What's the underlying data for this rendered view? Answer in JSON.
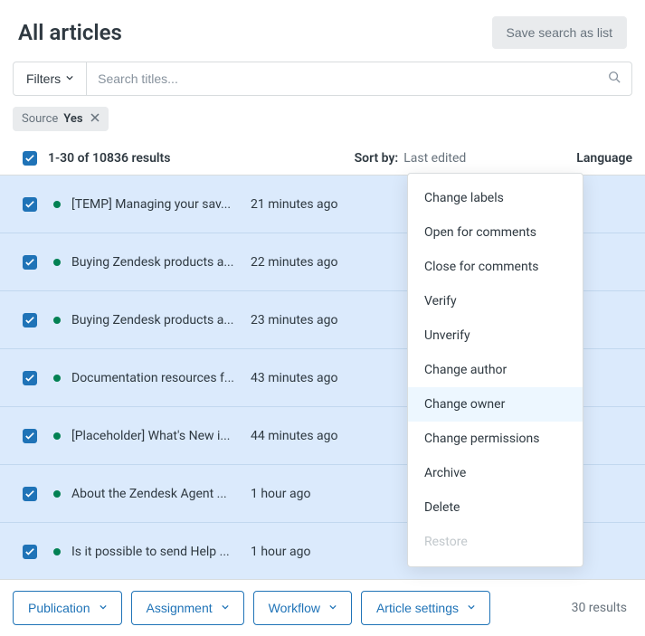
{
  "header": {
    "title": "All articles",
    "save_search": "Save search as list"
  },
  "filters": {
    "button": "Filters",
    "search_placeholder": "Search titles..."
  },
  "chip": {
    "label": "Source",
    "value": "Yes"
  },
  "list_header": {
    "count": "1-30 of 10836 results",
    "sort_label": "Sort by:",
    "sort_value": "Last edited",
    "language": "Language"
  },
  "rows": [
    {
      "title": "[TEMP] Managing your sav...",
      "time": "21 minutes ago"
    },
    {
      "title": "Buying Zendesk products a...",
      "time": "22 minutes ago"
    },
    {
      "title": "Buying Zendesk products a...",
      "time": "23 minutes ago"
    },
    {
      "title": "Documentation resources f...",
      "time": "43 minutes ago"
    },
    {
      "title": "[Placeholder] What's New i...",
      "time": "44 minutes ago"
    },
    {
      "title": "About the Zendesk Agent ...",
      "time": "1 hour ago"
    },
    {
      "title": "Is it possible to send Help ...",
      "time": "1 hour ago"
    }
  ],
  "menu": {
    "items": [
      {
        "label": "Change labels"
      },
      {
        "label": "Open for comments"
      },
      {
        "label": "Close for comments"
      },
      {
        "label": "Verify"
      },
      {
        "label": "Unverify"
      },
      {
        "label": "Change author"
      },
      {
        "label": "Change owner",
        "highlight": true
      },
      {
        "label": "Change permissions"
      },
      {
        "label": "Archive"
      },
      {
        "label": "Delete"
      },
      {
        "label": "Restore",
        "disabled": true
      }
    ]
  },
  "action_bar": {
    "publication": "Publication",
    "assignment": "Assignment",
    "workflow": "Workflow",
    "article_settings": "Article settings",
    "count": "30 results"
  }
}
